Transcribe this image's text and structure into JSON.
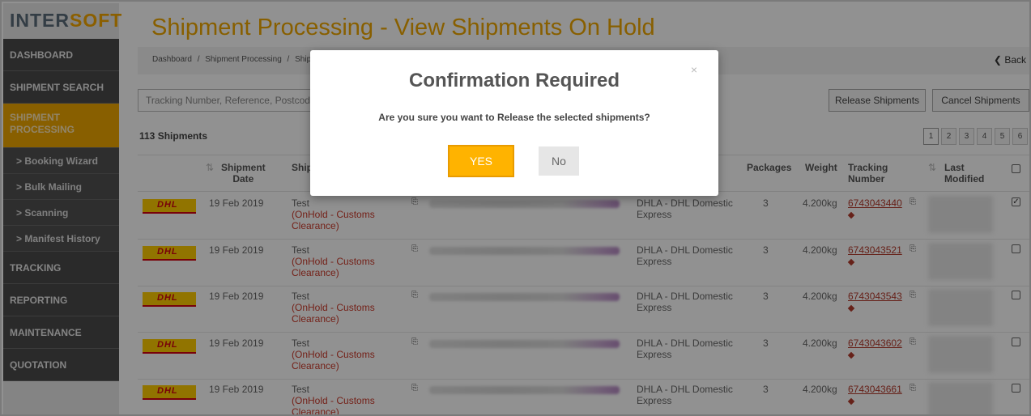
{
  "brand": {
    "logo_prefix": "INTER",
    "logo_suffix": "SOFT"
  },
  "sidebar": {
    "items": [
      {
        "label": "DASHBOARD"
      },
      {
        "label": "SHIPMENT SEARCH"
      },
      {
        "label": "SHIPMENT\nPROCESSING",
        "active": true
      },
      {
        "label": "TRACKING"
      },
      {
        "label": "REPORTING"
      },
      {
        "label": "MAINTENANCE"
      },
      {
        "label": "QUOTATION"
      }
    ],
    "subitems": [
      {
        "label": "> Booking Wizard"
      },
      {
        "label": "> Bulk Mailing"
      },
      {
        "label": "> Scanning"
      },
      {
        "label": "> Manifest History"
      }
    ]
  },
  "page": {
    "title": "Shipment Processing - View Shipments On Hold",
    "breadcrumb": [
      "Dashboard",
      "/",
      "Shipment Processing",
      "/",
      "Shipm"
    ],
    "back_label": "Back",
    "search_placeholder": "Tracking Number, Reference, Postcode",
    "release_label": "Release Shipments",
    "cancel_label": "Cancel Shipments",
    "count_label": "113 Shipments",
    "pages": [
      "1",
      "2",
      "3",
      "4",
      "5",
      "6"
    ]
  },
  "table": {
    "headers": {
      "shipment_date": "Shipment\nDate",
      "ship": "Ship",
      "packages": "Packages",
      "weight": "Weight",
      "tracking": "Tracking\nNumber",
      "modified": "Last\nModified"
    },
    "rows": [
      {
        "date": "19 Feb 2019",
        "ref": "Test",
        "status": "(OnHold - Customs\nClearance)",
        "service": "DHLA - DHL Domestic\nExpress",
        "packages": "3",
        "weight": "4.200kg",
        "tracking": "6743043440",
        "checked": true
      },
      {
        "date": "19 Feb 2019",
        "ref": "Test",
        "status": "(OnHold - Customs\nClearance)",
        "service": "DHLA - DHL Domestic\nExpress",
        "packages": "3",
        "weight": "4.200kg",
        "tracking": "6743043521",
        "checked": false
      },
      {
        "date": "19 Feb 2019",
        "ref": "Test",
        "status": "(OnHold - Customs\nClearance)",
        "service": "DHLA - DHL Domestic\nExpress",
        "packages": "3",
        "weight": "4.200kg",
        "tracking": "6743043543",
        "checked": false
      },
      {
        "date": "19 Feb 2019",
        "ref": "Test",
        "status": "(OnHold - Customs\nClearance)",
        "service": "DHLA - DHL Domestic\nExpress",
        "packages": "3",
        "weight": "4.200kg",
        "tracking": "6743043602",
        "checked": false
      },
      {
        "date": "19 Feb 2019",
        "ref": "Test",
        "status": "(OnHold - Customs\nClearance)",
        "service": "DHLA - DHL Domestic\nExpress",
        "packages": "3",
        "weight": "4.200kg",
        "tracking": "6743043661",
        "checked": false
      }
    ],
    "carrier_logo": "DHL"
  },
  "modal": {
    "title": "Confirmation Required",
    "message": "Are you sure you want to Release the selected shipments?",
    "yes_label": "YES",
    "no_label": "No",
    "close_glyph": "×"
  },
  "colors": {
    "brand_orange": "#f0a800",
    "sidebar_dark": "#4a4a4a",
    "yes_button": "#ffb300",
    "hold_red": "#cc3a2b"
  }
}
